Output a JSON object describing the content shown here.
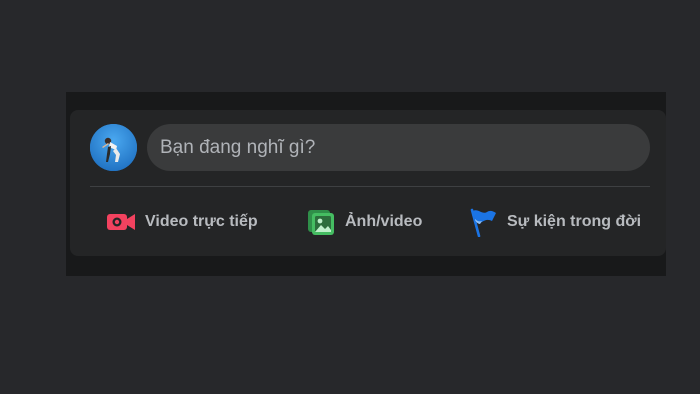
{
  "composer": {
    "prompt_placeholder": "Bạn đang nghĩ gì?",
    "actions": [
      {
        "label": "Video trực tiếp",
        "icon": "live-video-icon",
        "color": "#f3425f"
      },
      {
        "label": "Ảnh/video",
        "icon": "photo-video-icon",
        "color": "#45bd62"
      },
      {
        "label": "Sự kiện trong đời",
        "icon": "life-event-flag-icon",
        "color": "#1b74e4"
      }
    ]
  },
  "colors": {
    "page_background": "#27282b",
    "card_background": "#242526",
    "input_background": "#3a3b3c",
    "secondary_text": "#b0b3b8"
  }
}
